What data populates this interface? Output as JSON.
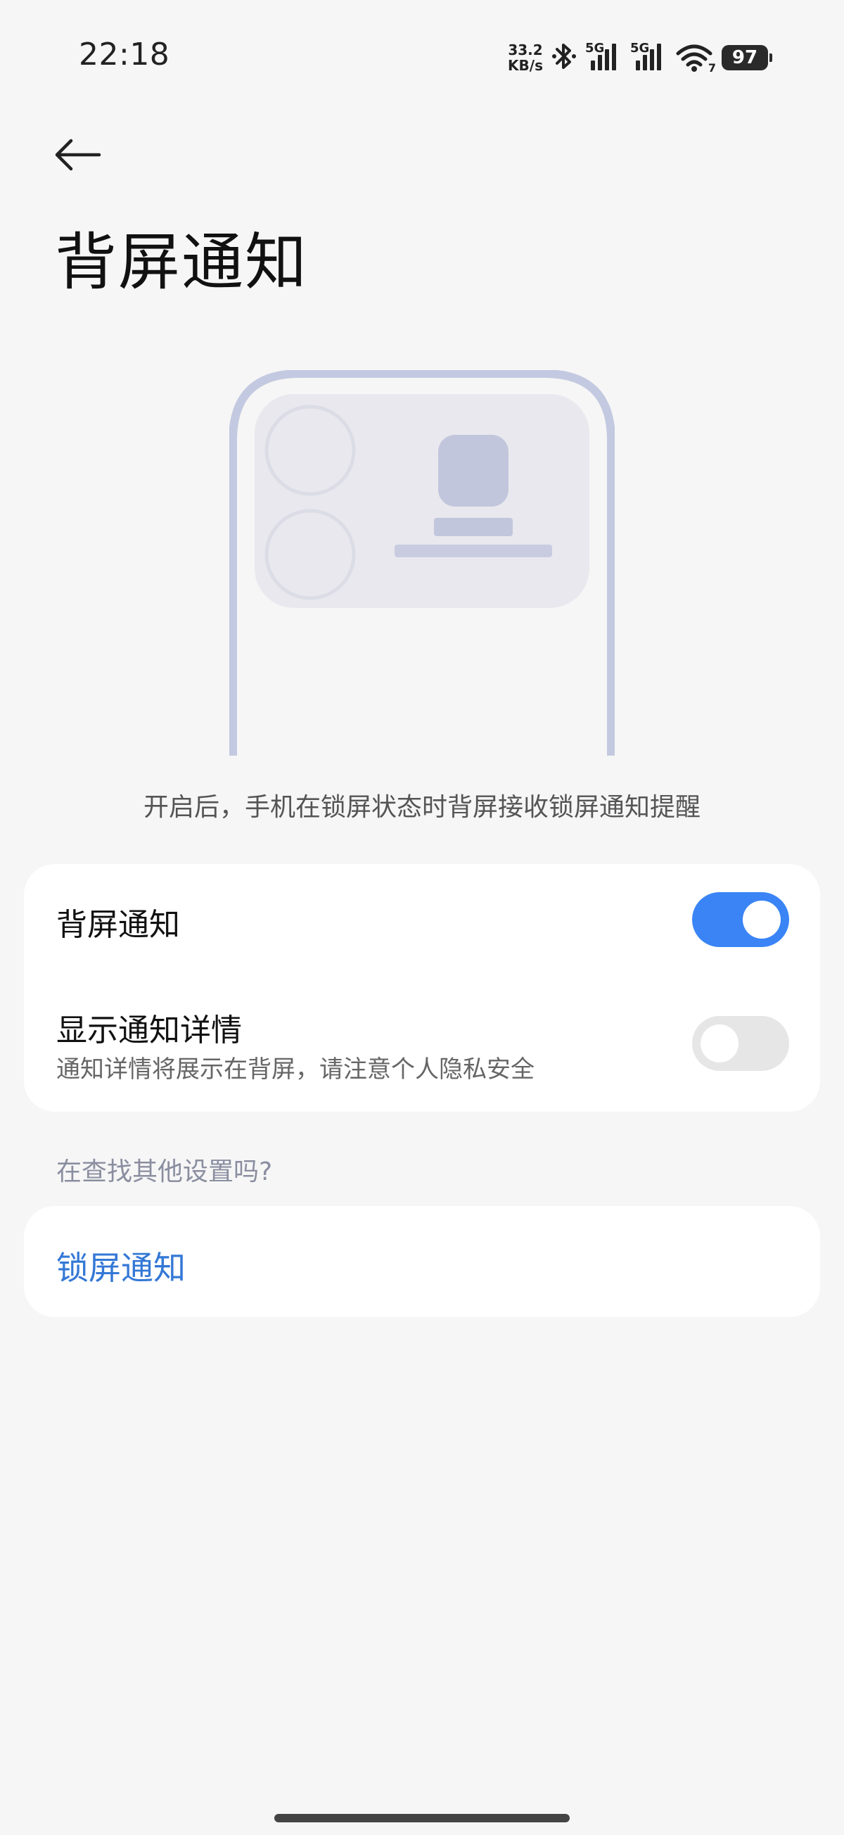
{
  "status_bar": {
    "time": "22:18",
    "net_speed_value": "33.2",
    "net_speed_unit": "KB/s",
    "sim1_label": "5G",
    "sim2_label": "5G",
    "wifi_badge": "7",
    "battery": "97",
    "icons": [
      "bluetooth-icon",
      "signal-icon",
      "signal-icon",
      "wifi-icon",
      "battery-icon"
    ]
  },
  "header": {
    "back_icon": "back-arrow-icon",
    "title": "背屏通知"
  },
  "illustration": {
    "icon": "phone-rear-screen-illustration",
    "colors": {
      "frame": "#c3c9e0",
      "screen": "#e8e8ee",
      "block": "#c2c6dc"
    }
  },
  "description": "开启后，手机在锁屏状态时背屏接收锁屏通知提醒",
  "settings": {
    "rear_notification": {
      "label": "背屏通知",
      "enabled": true
    },
    "show_details": {
      "label": "显示通知详情",
      "sublabel": "通知详情将展示在背屏，请注意个人隐私安全",
      "enabled": false
    }
  },
  "related": {
    "header": "在查找其他设置吗?",
    "links": [
      {
        "label": "锁屏通知"
      }
    ]
  },
  "colors": {
    "accent": "#3a84f5",
    "link": "#3478d6",
    "background": "#f6f6f6",
    "card": "#ffffff"
  }
}
